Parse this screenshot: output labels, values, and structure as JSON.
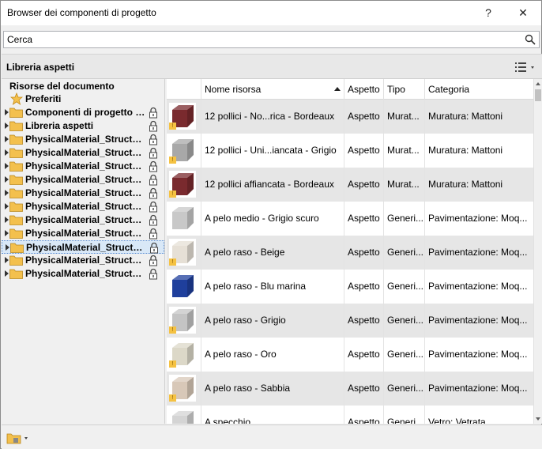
{
  "window": {
    "title": "Browser dei componenti di progetto",
    "help_label": "?",
    "close_label": "✕"
  },
  "search": {
    "placeholder": "Cerca",
    "value": "Cerca"
  },
  "library_header": {
    "title": "Libreria aspetti"
  },
  "tree": {
    "header": "Risorse del documento",
    "favorites": "Preferiti",
    "items": [
      {
        "label": "Componenti di progetto f...",
        "locked": true,
        "selected": false
      },
      {
        "label": "Libreria aspetti",
        "locked": true,
        "selected": false
      },
      {
        "label": "PhysicalMaterial_Structur...",
        "locked": true,
        "selected": false
      },
      {
        "label": "PhysicalMaterial_Structur...",
        "locked": true,
        "selected": false
      },
      {
        "label": "PhysicalMaterial_Structur...",
        "locked": true,
        "selected": false
      },
      {
        "label": "PhysicalMaterial_Structur...",
        "locked": true,
        "selected": false
      },
      {
        "label": "PhysicalMaterial_Structur...",
        "locked": true,
        "selected": false
      },
      {
        "label": "PhysicalMaterial_Structur...",
        "locked": true,
        "selected": false
      },
      {
        "label": "PhysicalMaterial_Structur...",
        "locked": true,
        "selected": false
      },
      {
        "label": "PhysicalMaterial_Structur...",
        "locked": true,
        "selected": false
      },
      {
        "label": "PhysicalMaterial_Structur...",
        "locked": true,
        "selected": true
      },
      {
        "label": "PhysicalMaterial_Structur...",
        "locked": true,
        "selected": false
      },
      {
        "label": "PhysicalMaterial_Structur...",
        "locked": true,
        "selected": false
      }
    ]
  },
  "grid": {
    "columns": {
      "name": "Nome risorsa",
      "aspect": "Aspetto",
      "type": "Tipo",
      "category": "Categoria"
    },
    "rows": [
      {
        "name": "12 pollici - No...rica - Bordeaux",
        "aspect": "Aspetto",
        "type": "Murat...",
        "category": "Muratura: Mattoni",
        "swatch": "#7a2a2e",
        "warn": true
      },
      {
        "name": "12 pollici - Uni...iancata - Grigio",
        "aspect": "Aspetto",
        "type": "Murat...",
        "category": "Muratura: Mattoni",
        "swatch": "#a8a8a8",
        "warn": true
      },
      {
        "name": "12 pollici affiancata - Bordeaux",
        "aspect": "Aspetto",
        "type": "Murat...",
        "category": "Muratura: Mattoni",
        "swatch": "#7a2a2e",
        "warn": true
      },
      {
        "name": "A pelo medio - Grigio scuro",
        "aspect": "Aspetto",
        "type": "Generi...",
        "category": "Pavimentazione: Moq...",
        "swatch": "#c8c8c8",
        "warn": false
      },
      {
        "name": "A pelo raso - Beige",
        "aspect": "Aspetto",
        "type": "Generi...",
        "category": "Pavimentazione: Moq...",
        "swatch": "#e6e0d6",
        "warn": true
      },
      {
        "name": "A pelo raso - Blu marina",
        "aspect": "Aspetto",
        "type": "Generi...",
        "category": "Pavimentazione: Moq...",
        "swatch": "#1f3f9c",
        "warn": false
      },
      {
        "name": "A pelo raso - Grigio",
        "aspect": "Aspetto",
        "type": "Generi...",
        "category": "Pavimentazione: Moq...",
        "swatch": "#c4c4c4",
        "warn": true
      },
      {
        "name": "A pelo raso - Oro",
        "aspect": "Aspetto",
        "type": "Generi...",
        "category": "Pavimentazione: Moq...",
        "swatch": "#dcd8c8",
        "warn": true
      },
      {
        "name": "A pelo raso - Sabbia",
        "aspect": "Aspetto",
        "type": "Generi...",
        "category": "Pavimentazione: Moq...",
        "swatch": "#d8c8b8",
        "warn": true
      },
      {
        "name": "A specchio",
        "aspect": "Aspetto",
        "type": "Generi...",
        "category": "Vetro: Vetrata",
        "swatch": "#d4d4d4",
        "warn": false
      }
    ]
  },
  "colors": {
    "selection": "#d9e8f7",
    "folder": "#f3c04d",
    "alt_row": "#e6e6e6"
  }
}
